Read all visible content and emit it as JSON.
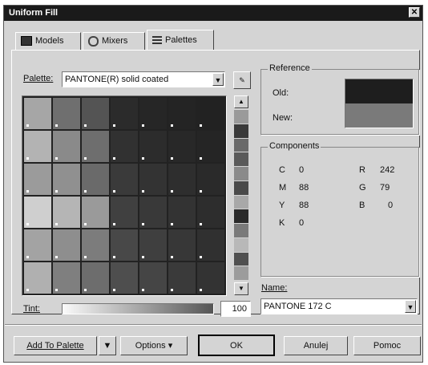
{
  "window": {
    "title": "Uniform Fill"
  },
  "tabs": [
    {
      "label": "Models"
    },
    {
      "label": "Mixers"
    },
    {
      "label": "Palettes"
    }
  ],
  "palette": {
    "label": "Palette:",
    "value": "PANTONE(R) solid coated"
  },
  "reference": {
    "title": "Reference",
    "old_label": "Old:",
    "new_label": "New:",
    "old_color": "#1e1e1e",
    "new_color": "#7a7a7a"
  },
  "components": {
    "title": "Components",
    "left": [
      {
        "k": "C",
        "v": "0"
      },
      {
        "k": "M",
        "v": "88"
      },
      {
        "k": "Y",
        "v": "88"
      },
      {
        "k": "K",
        "v": "0"
      }
    ],
    "right": [
      {
        "k": "R",
        "v": "242"
      },
      {
        "k": "G",
        "v": "79"
      },
      {
        "k": "B",
        "v": "0"
      }
    ]
  },
  "name": {
    "label": "Name:",
    "value": "PANTONE 172 C"
  },
  "tint": {
    "label": "Tint:",
    "value": "100",
    "level_percent": 100
  },
  "buttons": {
    "add_to_palette": "Add To Palette",
    "options": "Options ▾",
    "ok": "OK",
    "cancel": "Anulej",
    "help": "Pomoc"
  },
  "swatch_colors": [
    [
      "#a6a6a6",
      "#6f6f6f",
      "#545454",
      "#2b2b2b",
      "#262626",
      "#242424",
      "#222222"
    ],
    [
      "#b3b3b3",
      "#8a8a8a",
      "#6e6e6e",
      "#313131",
      "#2c2c2c",
      "#282828",
      "#252525"
    ],
    [
      "#9b9b9b",
      "#909090",
      "#6a6a6a",
      "#3a3a3a",
      "#333333",
      "#2e2e2e",
      "#2a2a2a"
    ],
    [
      "#cfcfcf",
      "#b5b5b5",
      "#9a9a9a",
      "#404040",
      "#393939",
      "#333333",
      "#2d2d2d"
    ],
    [
      "#a3a3a3",
      "#8e8e8e",
      "#7c7c7c",
      "#484848",
      "#3f3f3f",
      "#373737",
      "#303030"
    ],
    [
      "#b0b0b0",
      "#7f7f7f",
      "#6d6d6d",
      "#4e4e4e",
      "#454545",
      "#3a3a3a",
      "#333333"
    ]
  ],
  "strip_colors": [
    "#9a9a9a",
    "#3a3a3a",
    "#6a6a6a",
    "#5a5a5a",
    "#8a8a8a",
    "#4a4a4a",
    "#a8a8a8",
    "#2a2a2a",
    "#7a7a7a",
    "#b8b8b8",
    "#505050",
    "#9c9c9c"
  ]
}
